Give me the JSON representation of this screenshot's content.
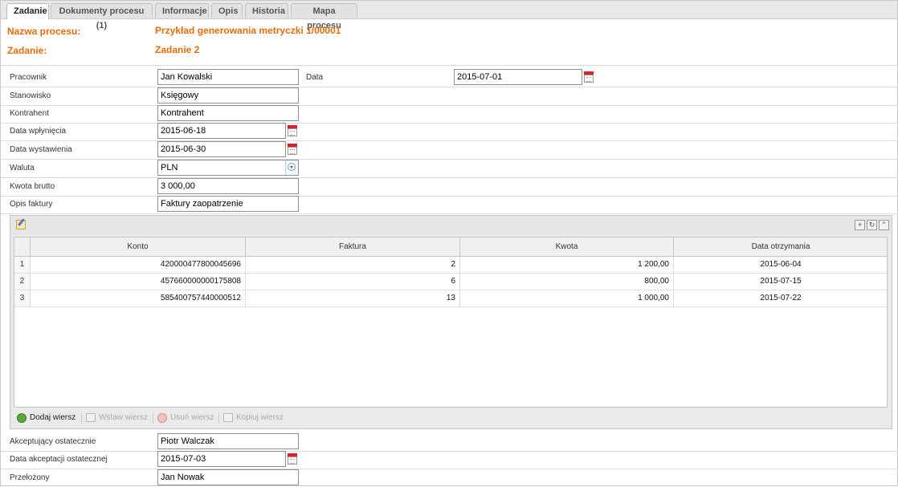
{
  "tabs": [
    {
      "label": "Zadanie",
      "active": true
    },
    {
      "label": "Dokumenty procesu (1)",
      "active": false
    },
    {
      "label": "Informacje",
      "active": false
    },
    {
      "label": "Opis",
      "active": false
    },
    {
      "label": "Historia",
      "active": false
    },
    {
      "label": "Mapa procesu",
      "active": false
    }
  ],
  "header": {
    "process_label": "Nazwa procesu:",
    "process_value": "Przykład generowania metryczki 1/00001",
    "task_label": "Zadanie:",
    "task_value": "Zadanie 2",
    "accent_color": "#e36c0a"
  },
  "form": {
    "pracownik": {
      "label": "Pracownik",
      "value": "Jan Kowalski"
    },
    "data": {
      "label": "Data",
      "value": "2015-07-01"
    },
    "stanowisko": {
      "label": "Stanowisko",
      "value": "Księgowy"
    },
    "kontrahent": {
      "label": "Kontrahent",
      "value": "Kontrahent"
    },
    "data_wplyniecia": {
      "label": "Data wpłynięcia",
      "value": "2015-06-18"
    },
    "data_wystawienia": {
      "label": "Data wystawienia",
      "value": "2015-06-30"
    },
    "waluta": {
      "label": "Waluta",
      "value": "PLN"
    },
    "kwota_brutto": {
      "label": "Kwota brutto",
      "value": "3 000,00"
    },
    "opis_faktury": {
      "label": "Opis faktury",
      "value": "Faktury zaopatrzenie"
    },
    "akceptujacy": {
      "label": "Akceptujący ostatecznie",
      "value": "Piotr Walczak"
    },
    "data_akceptacji": {
      "label": "Data akceptacji ostatecznej",
      "value": "2015-07-03"
    },
    "przelozony": {
      "label": "Przełożony",
      "value": "Jan Nowak"
    }
  },
  "grid": {
    "columns": [
      "Konto",
      "Faktura",
      "Kwota",
      "Data otrzymania"
    ],
    "rows": [
      {
        "num": "1",
        "konto": "420000477800045696",
        "faktura": "2",
        "kwota": "1 200,00",
        "data": "2015-06-04"
      },
      {
        "num": "2",
        "konto": "457660000000175808",
        "faktura": "6",
        "kwota": "800,00",
        "data": "2015-07-15"
      },
      {
        "num": "3",
        "konto": "585400757440000512",
        "faktura": "13",
        "kwota": "1 000,00",
        "data": "2015-07-22"
      }
    ],
    "toolbar_icons": [
      "add-icon",
      "refresh-icon",
      "collapse-icon"
    ],
    "footer": {
      "add": "Dodaj wiersz",
      "insert": "Wstaw wiersz",
      "delete": "Usuń wiersz",
      "copy": "Kopiuj wiersz"
    }
  }
}
